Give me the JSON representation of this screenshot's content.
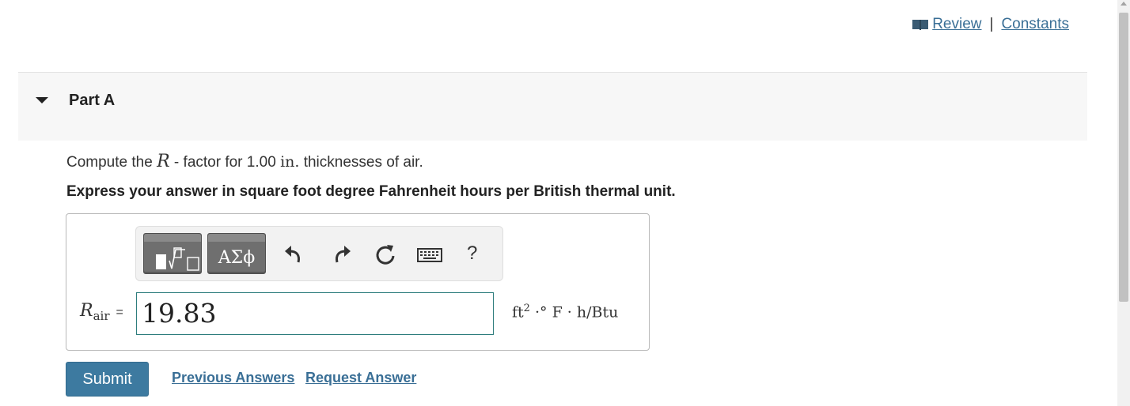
{
  "header": {
    "review_label": " Review",
    "separator": "|",
    "constants_label": "Constants"
  },
  "part": {
    "title": "Part A"
  },
  "question": {
    "prefix": "Compute the ",
    "symbol": "R",
    "middle": " - factor for 1.00 ",
    "unit": "in.",
    "suffix": " thicknesses of air."
  },
  "instruction": "Express your answer in square foot degree Fahrenheit hours per British thermal unit.",
  "toolbar": {
    "greek_label": "ΑΣϕ",
    "help_label": "?",
    "icons": [
      "templates-icon",
      "greek-letters-icon",
      "undo-icon",
      "redo-icon",
      "reset-icon",
      "keyboard-icon",
      "help-icon"
    ]
  },
  "answer": {
    "var_symbol": "R",
    "var_subscript": "air",
    "equals": "=",
    "value": "19.83",
    "units_pre": "ft",
    "units_exp": "2",
    "units_post": " ·° F · h/Btu"
  },
  "actions": {
    "submit_label": "Submit",
    "previous_label": "Previous Answers",
    "request_label": "Request Answer"
  },
  "colors": {
    "link": "#3a6f96",
    "submit_bg": "#3d7aa0",
    "input_border": "#2e7d7d",
    "part_header_bg": "#f7f7f7"
  }
}
